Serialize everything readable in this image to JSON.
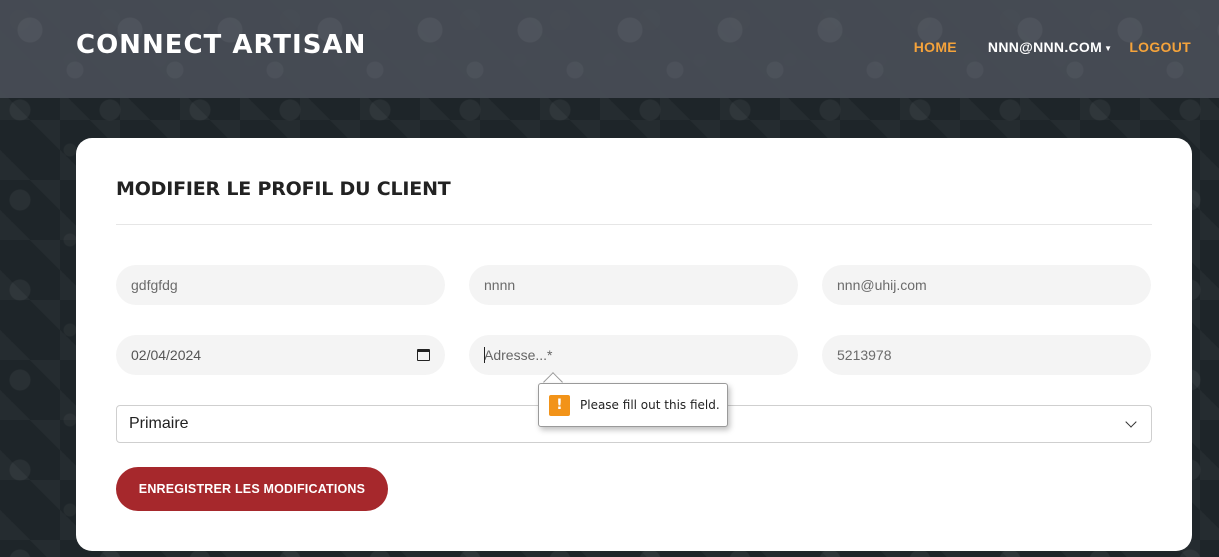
{
  "navbar": {
    "brand": "CONNECT ARTISAN",
    "home_label": "HOME",
    "user_label": "NNN@NNN.COM",
    "user_chevron": "⌄",
    "logout_label": "LOGOUT"
  },
  "form": {
    "title": "MODIFIER LE PROFIL DU CLIENT",
    "fields": {
      "field1_value": "gdfgfdg",
      "field2_value": "nnnn",
      "email_value": "nnn@uhij.com",
      "date_value": "02/04/2024",
      "address_placeholder": "Adresse...*",
      "address_value": "",
      "phone_value": "5213978"
    },
    "select": {
      "selected": "Primaire"
    },
    "save_label": "ENREGISTRER LES MODIFICATIONS"
  },
  "validation": {
    "message": "Please fill out this field.",
    "icon": "!"
  },
  "colors": {
    "accent": "#f5a33b",
    "button": "#a6282c",
    "warning": "#f29318"
  }
}
